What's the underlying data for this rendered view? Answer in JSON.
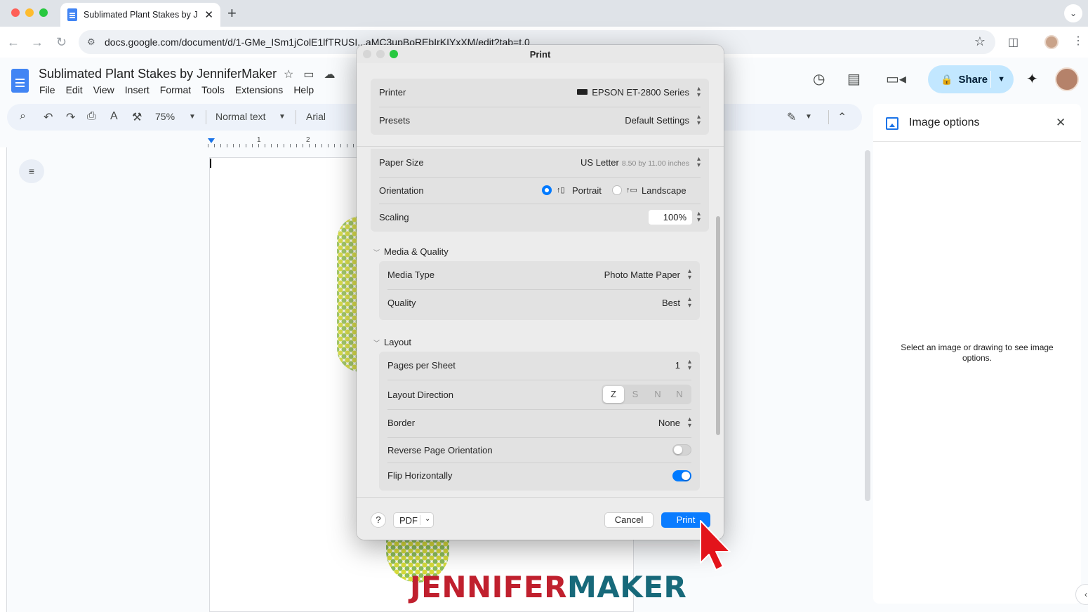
{
  "browser": {
    "tab_title": "Sublimated Plant Stakes by J",
    "tab_close": "✕",
    "new_tab": "+",
    "tab_menu": "⌄",
    "url": "docs.google.com/document/d/1-GMe_ISm1jColE1lfTRUSI...aMC3upBoREbIrKIYxXM/edit?tab=t.0",
    "back": "←",
    "forward": "→",
    "reload": "↻",
    "star": "☆",
    "menu": "⋮"
  },
  "docs": {
    "title": "Sublimated Plant Stakes by JenniferMaker",
    "menus": [
      "File",
      "Edit",
      "View",
      "Insert",
      "Format",
      "Tools",
      "Extensions",
      "Help"
    ],
    "share_label": "Share",
    "zoom": "75%",
    "style": "Normal text",
    "font": "Arial",
    "ruler_1": "1",
    "ruler_2": "2"
  },
  "side_panel": {
    "title": "Image options",
    "close": "✕",
    "message": "Select an image or drawing to see image options."
  },
  "print_dialog": {
    "title": "Print",
    "printer_label": "Printer",
    "printer_value": "EPSON ET-2800 Series",
    "presets_label": "Presets",
    "presets_value": "Default Settings",
    "paper_size_label": "Paper Size",
    "paper_size_value": "US Letter",
    "paper_size_sub": "8.50 by 11.00 inches",
    "orientation_label": "Orientation",
    "portrait": "Portrait",
    "landscape": "Landscape",
    "orientation_selected": "Portrait",
    "scaling_label": "Scaling",
    "scaling_value": "100%",
    "media_section": "Media & Quality",
    "media_type_label": "Media Type",
    "media_type_value": "Photo Matte Paper",
    "quality_label": "Quality",
    "quality_value": "Best",
    "layout_section": "Layout",
    "pages_per_sheet_label": "Pages per Sheet",
    "pages_per_sheet_value": "1",
    "layout_direction_label": "Layout Direction",
    "layout_direction_options": [
      "Z",
      "S",
      "N",
      "N"
    ],
    "border_label": "Border",
    "border_value": "None",
    "reverse_label": "Reverse Page Orientation",
    "reverse_on": false,
    "flip_label": "Flip Horizontally",
    "flip_on": true,
    "help": "?",
    "pdf": "PDF",
    "cancel": "Cancel",
    "print": "Print"
  },
  "watermark": {
    "part1": "JENNIFER",
    "part2": "MAKER"
  },
  "colors": {
    "accent_blue": "#0a7cff",
    "share_bg": "#c2e7ff",
    "brand_red": "#c0202e",
    "brand_teal": "#17697a"
  }
}
